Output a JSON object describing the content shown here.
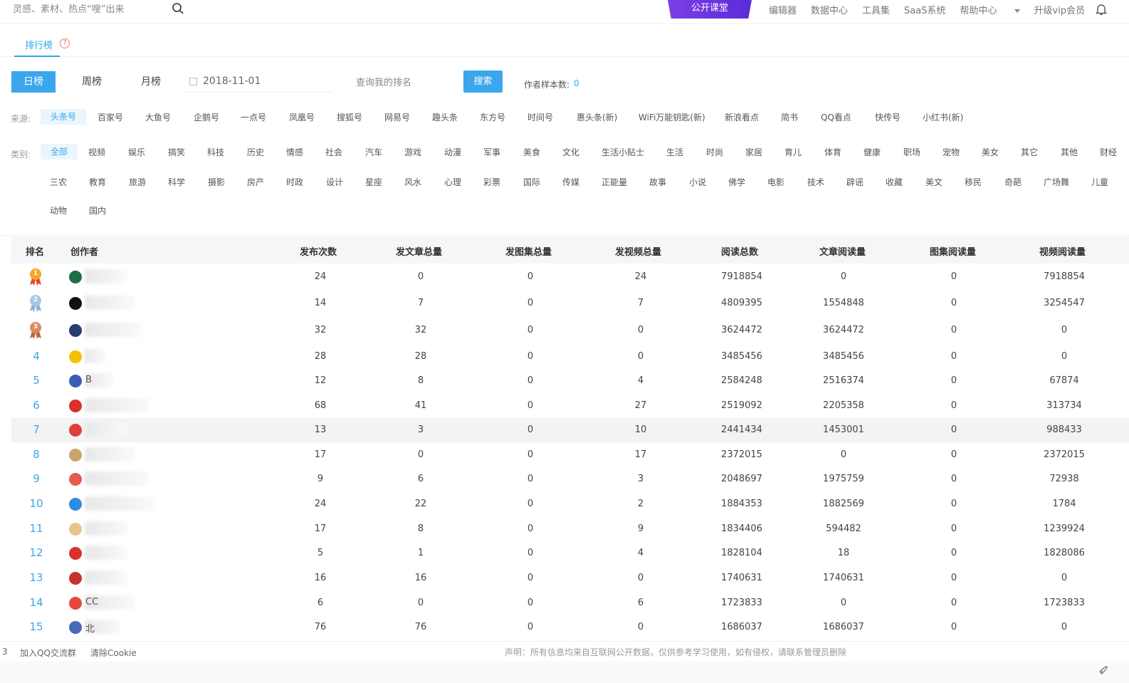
{
  "topbar": {
    "search_placeholder": "灵感、素材、热点“嗖”出来",
    "public_class": "公开课堂",
    "nav": [
      "编辑器",
      "数据中心",
      "工具集",
      "SaaS系统",
      "帮助中心",
      "升级vip会员"
    ]
  },
  "tab": {
    "label": "排行榜",
    "help": "?"
  },
  "period": {
    "buttons": [
      "日榜",
      "周榜",
      "月榜"
    ],
    "active": "日榜",
    "date": "2018-11-01",
    "query_placeholder": "查询我的排名",
    "search_label": "搜索",
    "sample_label": "作者样本数:",
    "sample_value": "0"
  },
  "source": {
    "label": "来源:",
    "items": [
      "头条号",
      "百家号",
      "大鱼号",
      "企鹅号",
      "一点号",
      "凤凰号",
      "搜狐号",
      "网易号",
      "趣头条",
      "东方号",
      "时间号",
      "惠头条(新)",
      "WiFi万能钥匙(新)",
      "新浪看点",
      "简书",
      "QQ看点",
      "快传号",
      "小红书(新)"
    ]
  },
  "category": {
    "label": "类别:",
    "row1": [
      "全部",
      "视频",
      "娱乐",
      "搞笑",
      "科技",
      "历史",
      "情感",
      "社会",
      "汽车",
      "游戏",
      "动漫",
      "军事",
      "美食",
      "文化",
      "生活小贴士",
      "生活",
      "时尚",
      "家居",
      "育儿",
      "体育",
      "健康",
      "职场",
      "宠物",
      "美女",
      "其它",
      "其他",
      "财经"
    ],
    "row2": [
      "三农",
      "教育",
      "旅游",
      "科学",
      "摄影",
      "房产",
      "时政",
      "设计",
      "星座",
      "风水",
      "心理",
      "彩票",
      "国际",
      "传媒",
      "正能量",
      "故事",
      "小说",
      "佛学",
      "电影",
      "技术",
      "辟谣",
      "收藏",
      "美文",
      "移民",
      "奇葩",
      "广场舞",
      "儿童"
    ],
    "row3": [
      "动物",
      "国内"
    ]
  },
  "table": {
    "headers": [
      "排名",
      "创作者",
      "发布次数",
      "发文章总量",
      "发图集总量",
      "发视频总量",
      "阅读总数",
      "文章阅读量",
      "图集阅读量",
      "视频阅读量"
    ],
    "rows": [
      {
        "rank": "1",
        "name": "",
        "v": [
          "24",
          "0",
          "0",
          "24",
          "7918854",
          "0",
          "0",
          "7918854"
        ]
      },
      {
        "rank": "2",
        "name": "",
        "v": [
          "14",
          "7",
          "0",
          "7",
          "4809395",
          "1554848",
          "0",
          "3254547"
        ]
      },
      {
        "rank": "3",
        "name": "",
        "v": [
          "32",
          "32",
          "0",
          "0",
          "3624472",
          "3624472",
          "0",
          "0"
        ]
      },
      {
        "rank": "4",
        "name": "",
        "v": [
          "28",
          "28",
          "0",
          "0",
          "3485456",
          "3485456",
          "0",
          "0"
        ]
      },
      {
        "rank": "5",
        "name": "B",
        "v": [
          "12",
          "8",
          "0",
          "4",
          "2584248",
          "2516374",
          "0",
          "67874"
        ]
      },
      {
        "rank": "6",
        "name": "",
        "v": [
          "68",
          "41",
          "0",
          "27",
          "2519092",
          "2205358",
          "0",
          "313734"
        ]
      },
      {
        "rank": "7",
        "name": "",
        "v": [
          "13",
          "3",
          "0",
          "10",
          "2441434",
          "1453001",
          "0",
          "988433"
        ]
      },
      {
        "rank": "8",
        "name": "",
        "v": [
          "17",
          "0",
          "0",
          "17",
          "2372015",
          "0",
          "0",
          "2372015"
        ]
      },
      {
        "rank": "9",
        "name": "",
        "v": [
          "9",
          "6",
          "0",
          "3",
          "2048697",
          "1975759",
          "0",
          "72938"
        ]
      },
      {
        "rank": "10",
        "name": "",
        "v": [
          "24",
          "22",
          "0",
          "2",
          "1884353",
          "1882569",
          "0",
          "1784"
        ]
      },
      {
        "rank": "11",
        "name": "",
        "v": [
          "17",
          "8",
          "0",
          "9",
          "1834406",
          "594482",
          "0",
          "1239924"
        ]
      },
      {
        "rank": "12",
        "name": "",
        "v": [
          "5",
          "1",
          "0",
          "4",
          "1828104",
          "18",
          "0",
          "1828086"
        ]
      },
      {
        "rank": "13",
        "name": "",
        "v": [
          "16",
          "16",
          "0",
          "0",
          "1740631",
          "1740631",
          "0",
          "0"
        ]
      },
      {
        "rank": "14",
        "name": "CC",
        "v": [
          "6",
          "0",
          "0",
          "6",
          "1723833",
          "0",
          "0",
          "1723833"
        ]
      },
      {
        "rank": "15",
        "name": "北",
        "v": [
          "76",
          "76",
          "0",
          "0",
          "1686037",
          "1686037",
          "0",
          "0"
        ]
      }
    ]
  },
  "footer": {
    "num": "3",
    "qq": "加入QQ交流群",
    "cookie": "清除Cookie",
    "notice": "声明：所有信息均来自互联网公开数据，仅供参考学习使用，如有侵权，请联系管理员删除"
  },
  "colors": {
    "accent": "#3ba6ec",
    "purple": "#6a33e0"
  }
}
